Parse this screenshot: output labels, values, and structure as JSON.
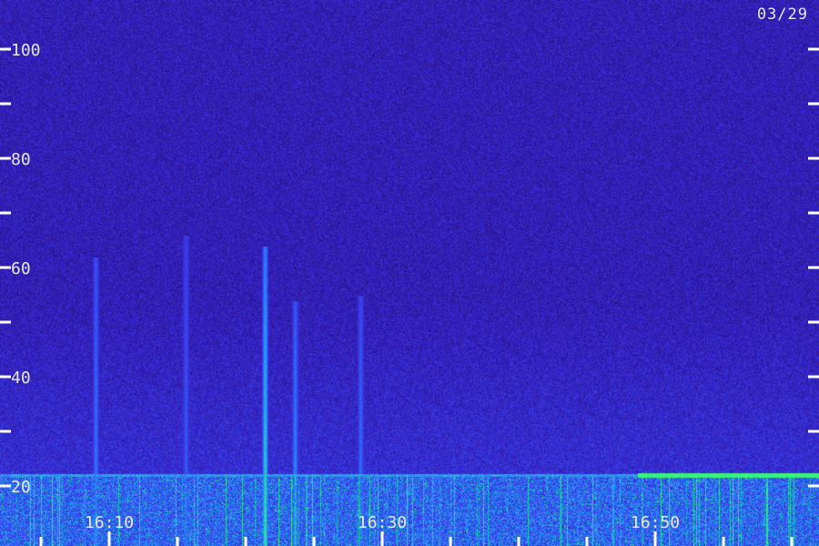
{
  "date_label": "03/29",
  "chart_data": {
    "type": "heatmap",
    "title": "",
    "xlabel": "",
    "ylabel": "",
    "x_tick_labels": [
      "16:10",
      "16:30",
      "16:50"
    ],
    "x_tick_values_minutes": [
      10,
      30,
      50
    ],
    "x_range_minutes": [
      2,
      62
    ],
    "y_tick_labels": [
      "20",
      "40",
      "60",
      "80",
      "100"
    ],
    "y_tick_values": [
      20,
      40,
      60,
      80,
      100
    ],
    "y_minor_ticks": [
      30,
      50,
      70,
      90
    ],
    "y_range": [
      9,
      109
    ],
    "colormap": [
      "#1a0a4a",
      "#2a1290",
      "#3a30e0",
      "#2a80ff",
      "#20d0c0",
      "#40ff60"
    ],
    "features": {
      "low_frequency_band": {
        "y_min": 9,
        "y_max": 22,
        "intensity": "high"
      },
      "horizontal_line": {
        "y": 22,
        "x_start_minutes": 2,
        "x_end_minutes": 62
      },
      "bright_segment": {
        "y": 22,
        "x_start_minutes": 48.7,
        "x_end_minutes": 62
      },
      "vertical_bursts": [
        {
          "x_minutes": 9.0,
          "y_top": 62,
          "strength": 0.5
        },
        {
          "x_minutes": 15.6,
          "y_top": 66,
          "strength": 0.35
        },
        {
          "x_minutes": 21.4,
          "y_top": 64,
          "strength": 1.0
        },
        {
          "x_minutes": 23.6,
          "y_top": 54,
          "strength": 0.6
        },
        {
          "x_minutes": 28.4,
          "y_top": 55,
          "strength": 0.45
        }
      ]
    }
  }
}
